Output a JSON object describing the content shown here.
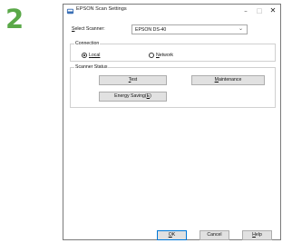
{
  "step_number": "2",
  "window": {
    "title": "EPSON Scan Settings",
    "controls": {
      "minimize": "–",
      "maximize": "□",
      "close": "✕"
    }
  },
  "scanner": {
    "label_prefix": "S",
    "label_rest": "elect Scanner:",
    "selected": "EPSON DS-40"
  },
  "connection": {
    "title": "Connection",
    "local": {
      "mnemonic": "L",
      "rest": "ocal",
      "checked": true
    },
    "network": {
      "mnemonic": "N",
      "rest": "etwork",
      "checked": false
    }
  },
  "status": {
    "title": "Scanner Status",
    "test": {
      "mnemonic": "T",
      "rest": "est"
    },
    "maintenance": {
      "mnemonic": "M",
      "rest": "aintenance"
    },
    "energy_saving": {
      "pre": "Energy Saving(",
      "mnemonic": "E",
      "post": ")"
    }
  },
  "footer": {
    "ok": {
      "mnemonic": "O",
      "rest": "K"
    },
    "cancel": "Cancel",
    "help": {
      "mnemonic": "H",
      "rest": "elp"
    }
  },
  "colors": {
    "step_green": "#5aa848",
    "accent_blue": "#0078d7"
  }
}
